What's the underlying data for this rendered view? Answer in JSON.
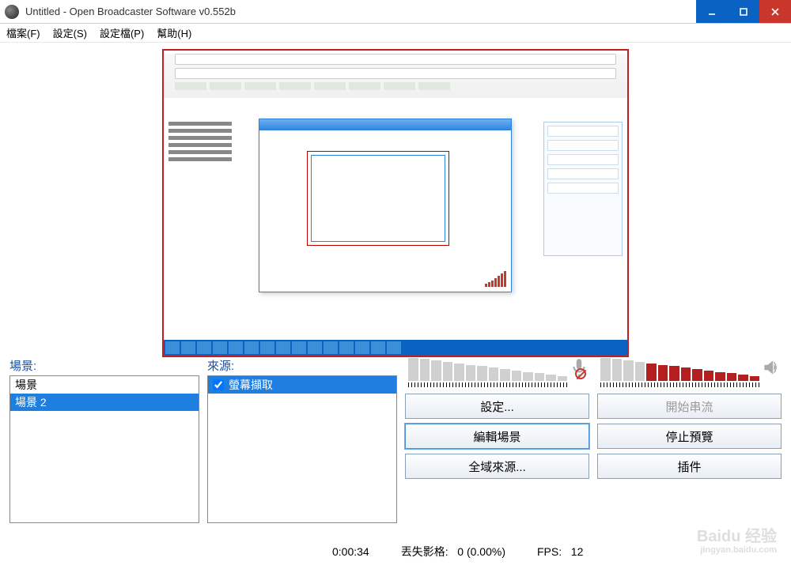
{
  "titlebar": {
    "title": "Untitled - Open Broadcaster Software v0.552b"
  },
  "menu": {
    "file": "檔案(F)",
    "settings": "設定(S)",
    "profiles": "設定檔(P)",
    "help": "幫助(H)"
  },
  "scenes": {
    "label": "場景:",
    "items": [
      {
        "label": "場景",
        "selected": false
      },
      {
        "label": "場景 2",
        "selected": true
      }
    ]
  },
  "sources": {
    "label": "來源:",
    "items": [
      {
        "label": "螢幕擷取",
        "checked": true,
        "selected": true
      }
    ]
  },
  "meters": {
    "mic": {
      "bars": 14,
      "active": 0,
      "muted": true,
      "icon": "mic-icon"
    },
    "desktop": {
      "bars": 14,
      "active": 10,
      "muted": false,
      "icon": "speaker-icon"
    }
  },
  "buttons": {
    "settings": "設定...",
    "start_stream": "開始串流",
    "edit_scene": "編輯場景",
    "stop_preview": "停止預覽",
    "global_sources": "全域來源...",
    "plugins": "插件"
  },
  "status": {
    "timer": "0:00:34",
    "dropped_label": "丟失影格:",
    "dropped_value": "0 (0.00%)",
    "fps_label": "FPS:",
    "fps_value": "12"
  },
  "watermark": {
    "brand": "Baidu 经验",
    "url": "jingyan.baidu.com"
  }
}
